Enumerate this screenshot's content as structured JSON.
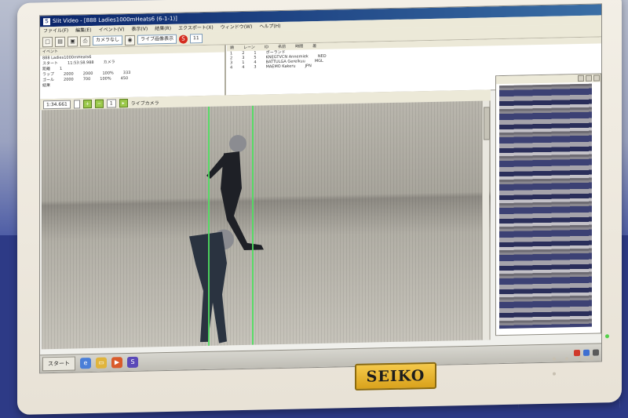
{
  "window": {
    "title": "Slit Video - [888 Ladies1000mHeats6 (6-1-1)]",
    "app_icon": "S"
  },
  "menu": [
    "ファイル(F)",
    "編集(E)",
    "イベント(V)",
    "表示(V)",
    "結果(R)",
    "エクスポート(X)",
    "ウィンドウ(W)",
    "ヘルプ(H)"
  ],
  "toolbar": {
    "camera_select": "カメラなし",
    "mode_select": "ライブ画像表示",
    "stop_label": "S",
    "counter": "11"
  },
  "event_panel": {
    "header": "イベント",
    "name": "888 Ladies1000mHeats6",
    "start_label": "スタート",
    "start_time": "11:53:58.988",
    "camera_label": "カメラ",
    "distance_label": "距離",
    "distance_value": "1",
    "rows": [
      {
        "label": "ラップ",
        "a": "2000",
        "b": "2000",
        "c": "100%",
        "d": "333"
      },
      {
        "label": "ゴール",
        "a": "2000",
        "b": "700",
        "c": "100%",
        "d": "450"
      }
    ],
    "result_label": "結果"
  },
  "results_panel": {
    "columns": [
      "順",
      "レーン",
      "ID",
      "名前",
      "時間",
      "差"
    ],
    "rows": [
      {
        "rank": "1",
        "lane": "2",
        "id": "1",
        "name": "ポーランド",
        "time": "",
        "diff": ""
      },
      {
        "rank": "2",
        "lane": "3",
        "id": "5",
        "name": "KNEGTVCN Annemiek",
        "time": "",
        "diff": "NED"
      },
      {
        "rank": "3",
        "lane": "1",
        "id": "4",
        "name": "BATTULGA Gerelkuu",
        "time": "",
        "diff": "MGL"
      },
      {
        "rank": "4",
        "lane": "4",
        "id": "3",
        "name": "MAEMO Kakeru",
        "time": "",
        "diff": "JPN"
      }
    ]
  },
  "video_bar": {
    "time_field": "1:34.661",
    "zoom_field": "",
    "page_field": "1",
    "mode_label": "ライブカメラ"
  },
  "taskbar": {
    "start_label": "スタート",
    "app_label": "S"
  },
  "monitor": {
    "brand": "SEIKO"
  },
  "colors": {
    "titlebar": "#0a246a",
    "finish_line": "#4fe061",
    "brand_plate": "#e2b02c"
  }
}
